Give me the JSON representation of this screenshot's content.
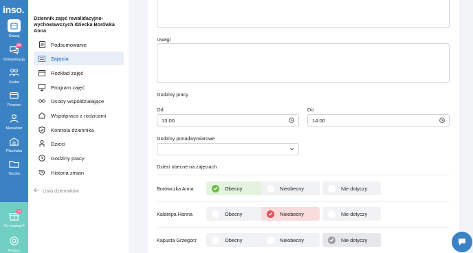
{
  "app": {
    "logo": "inso."
  },
  "rail": {
    "items": [
      {
        "label": "Dzisiaj",
        "icon": "calendar-icon"
      },
      {
        "label": "Komunikacja",
        "icon": "chat-bubbles-icon",
        "badge": "20"
      },
      {
        "label": "Kadra",
        "icon": "people-icon"
      },
      {
        "label": "Finanse",
        "icon": "wallet-icon"
      },
      {
        "label": "Menadżer",
        "icon": "user-manager-icon"
      },
      {
        "label": "Placówka",
        "icon": "building-icon"
      },
      {
        "label": "Teczka",
        "icon": "folder-icon"
      }
    ],
    "bottom": [
      {
        "label": "Co nowego?",
        "icon": "gift-icon",
        "badge": "14"
      },
      {
        "label": "Pomoc",
        "icon": "lifebuoy-icon"
      }
    ]
  },
  "menu": {
    "title": "Dziennik zajęć rewalidacyjno-wychowawczych dziecka Borówka Anna",
    "items": [
      {
        "label": "Podsumowanie",
        "icon": "document-icon"
      },
      {
        "label": "Zajęcia",
        "icon": "list-icon",
        "active": true
      },
      {
        "label": "Rozkład zajęć",
        "icon": "calendar-grid-icon"
      },
      {
        "label": "Program zajęć",
        "icon": "monitor-icon"
      },
      {
        "label": "Osoby współdziałające",
        "icon": "people-link-icon"
      },
      {
        "label": "Współpraca z rodzicami",
        "icon": "home-icon"
      },
      {
        "label": "Kontrola dziennika",
        "icon": "shield-check-icon"
      },
      {
        "label": "Dzieci",
        "icon": "child-icon"
      },
      {
        "label": "Godziny pracy",
        "icon": "clock-icon"
      },
      {
        "label": "Historia zmian",
        "icon": "history-icon"
      }
    ],
    "back_label": "Lista dzienników"
  },
  "form": {
    "uwagi_label": "Uwagi",
    "godziny_pracy_label": "Godziny pracy",
    "od_label": "Od",
    "od_value": "13:00",
    "do_label": "Do",
    "do_value": "14:00",
    "ponadwymiarowe_label": "Godziny ponadwymiarowe",
    "ponadwymiarowe_value": "",
    "attendance_label": "Dzieci obecne na zajęciach",
    "options": {
      "present": "Obecny",
      "absent": "Nieobecny",
      "na": "Nie dotyczy"
    },
    "children": [
      {
        "name": "Borówczka Anna",
        "status": "present"
      },
      {
        "name": "Kalarepa Hanna",
        "status": "absent"
      },
      {
        "name": "Kapusta Grzegorz",
        "status": "na"
      }
    ]
  },
  "colors": {
    "primary": "#3b82c4",
    "teal": "#6fcfc3",
    "present": "#6dbb4d",
    "absent": "#e0525b",
    "na": "#9c9fa5"
  }
}
